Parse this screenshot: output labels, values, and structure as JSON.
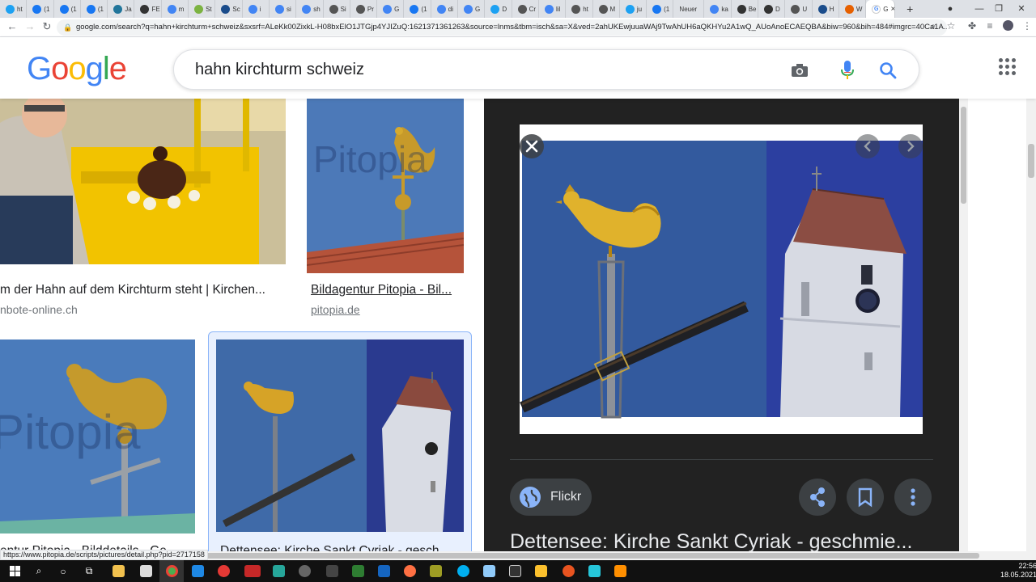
{
  "browser": {
    "tabs": [
      {
        "label": "ht",
        "icon": "twitter-icon",
        "color": "#1da1f2"
      },
      {
        "label": "(1",
        "icon": "facebook-icon",
        "color": "#1877f2"
      },
      {
        "label": "(1",
        "icon": "facebook-icon",
        "color": "#1877f2"
      },
      {
        "label": "(1",
        "icon": "facebook-icon",
        "color": "#1877f2"
      },
      {
        "label": "Ja",
        "icon": "wordpress-icon",
        "color": "#21759b"
      },
      {
        "label": "FE",
        "icon": "sz-icon",
        "color": "#333333"
      },
      {
        "label": "m",
        "icon": "google-icon",
        "color": "#4285f4"
      },
      {
        "label": "St",
        "icon": "leaf-icon",
        "color": "#7cb342"
      },
      {
        "label": "Sc",
        "icon": "news-icon",
        "color": "#1a4c8b"
      },
      {
        "label": "i",
        "icon": "google-icon",
        "color": "#4285f4"
      },
      {
        "label": "si",
        "icon": "google-icon",
        "color": "#4285f4"
      },
      {
        "label": "sh",
        "icon": "google-icon",
        "color": "#4285f4"
      },
      {
        "label": "Si",
        "icon": "globe-icon",
        "color": "#555555"
      },
      {
        "label": "Pr",
        "icon": "globe-icon",
        "color": "#555555"
      },
      {
        "label": "G",
        "icon": "translate-icon",
        "color": "#4285f4"
      },
      {
        "label": "(1",
        "icon": "facebook-icon",
        "color": "#1877f2"
      },
      {
        "label": "di",
        "icon": "google-icon",
        "color": "#4285f4"
      },
      {
        "label": "G",
        "icon": "translate-icon",
        "color": "#4285f4"
      },
      {
        "label": "D",
        "icon": "twitter-icon",
        "color": "#1da1f2"
      },
      {
        "label": "Cr",
        "icon": "globe-icon",
        "color": "#555555"
      },
      {
        "label": "lil",
        "icon": "google-icon",
        "color": "#4285f4"
      },
      {
        "label": "ht",
        "icon": "globe-icon",
        "color": "#555555"
      },
      {
        "label": "M",
        "icon": "globe-icon",
        "color": "#555555"
      },
      {
        "label": "ju",
        "icon": "twitter-icon",
        "color": "#1da1f2"
      },
      {
        "label": "(1",
        "icon": "facebook-icon",
        "color": "#1877f2"
      },
      {
        "label": "Neuer",
        "icon": "none",
        "color": "#dee1e6"
      },
      {
        "label": "ka",
        "icon": "google-icon",
        "color": "#4285f4"
      },
      {
        "label": "Be",
        "icon": "wikipedia-icon",
        "color": "#333333"
      },
      {
        "label": "D",
        "icon": "chat-icon",
        "color": "#333333"
      },
      {
        "label": "U",
        "icon": "globe-icon",
        "color": "#555555"
      },
      {
        "label": "H",
        "icon": "news-icon",
        "color": "#1a4c8b"
      },
      {
        "label": "W",
        "icon": "firefox-icon",
        "color": "#e66000"
      }
    ],
    "active_tab": {
      "label": "G",
      "icon": "google-icon"
    },
    "new_tab": "+",
    "url": "google.com/search?q=hahn+kirchturm+schweiz&sxsrf=ALeKk00ZixkL-H08bxElO1JTGjp4YJIZuQ:1621371361263&source=lnms&tbm=isch&sa=X&ved=2ahUKEwjuuaWAj9TwAhUH6aQKHYu2A1wQ_AUoAnoECAEQBA&biw=960&bih=484#imgrc=40Ca1A..."
  },
  "search": {
    "query": "hahn kirchturm schweiz",
    "logo": "Google"
  },
  "results": [
    {
      "caption": "m der Hahn auf dem Kirchturm steht | Kirchen...",
      "source": "nbote-online.ch"
    },
    {
      "caption": "Bildagentur Pitopia - Bil...",
      "source": "pitopia.de",
      "watermark": "Pitopia"
    },
    {
      "caption": "entur Pitopia - Bilddetails - Ge...",
      "source": "",
      "watermark": "Pitopia"
    },
    {
      "caption": "Dettensee: Kirche Sankt Cyriak - gesch...",
      "source": ""
    }
  ],
  "preview": {
    "source_label": "Flickr",
    "title": "Dettensee: Kirche Sankt Cyriak - geschmie..."
  },
  "status_url": "https://www.pitopia.de/scripts/pictures/detail.php?pid=2717158",
  "taskbar": {
    "time": "22:56",
    "date": "18.05.2021"
  }
}
